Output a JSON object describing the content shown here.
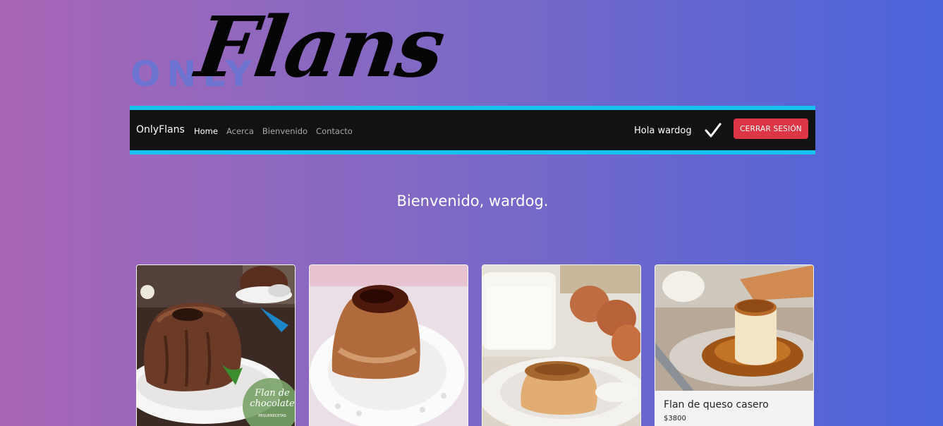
{
  "logo": {
    "small_text": "ONLY",
    "script_text": "Flans"
  },
  "navbar": {
    "brand": "OnlyFlans",
    "links": [
      {
        "label": "Home",
        "active": true
      },
      {
        "label": "Acerca",
        "active": false
      },
      {
        "label": "Bienvenido",
        "active": false
      },
      {
        "label": "Contacto",
        "active": false
      }
    ],
    "greeting": "Hola wardog",
    "status_icon": "checkmark-icon",
    "logout_label": "CERRAR SESIÓN"
  },
  "main": {
    "welcome": "Bienvenido, wardog."
  },
  "cards": [
    {
      "image": "flan-de-chocolate-image",
      "image_label_1": "Flan de",
      "image_label_2": "chocolate",
      "image_credit": "PEQUERECETAS"
    },
    {
      "image": "flan-image"
    },
    {
      "image": "flan-with-eggs-and-milk-image"
    },
    {
      "image": "flan-de-queso-image",
      "title": "Flan de queso casero",
      "price": "$3800"
    }
  ],
  "colors": {
    "navbar_bg": "#121212",
    "navbar_border": "#17c2ee",
    "logout_button": "#dc3545",
    "gradient_start": "#a966b6",
    "gradient_end": "#4b64db"
  }
}
